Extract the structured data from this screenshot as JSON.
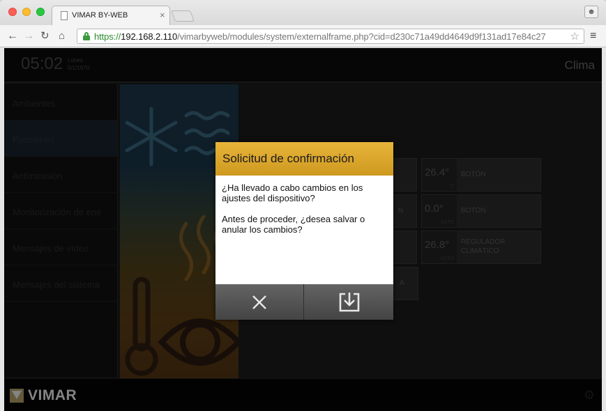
{
  "browser": {
    "tab_title": "VIMAR BY-WEB",
    "tab_close": "×",
    "url_scheme": "https://",
    "url_host": "192.168.2.110",
    "url_path": "/vimarbyweb/modules/system/externalframe.php?cid=d230c71a49dd4649d9f131ad17e84c27",
    "icons": [
      "back-arrow-icon",
      "forward-arrow-icon",
      "reload-icon",
      "home-icon",
      "lock-icon",
      "star-icon",
      "menu-icon",
      "user-icon"
    ]
  },
  "header": {
    "time": "05:02",
    "day": "Lunes",
    "date": "5/1/1970",
    "section": "Clima"
  },
  "sidebar": {
    "items": [
      {
        "label": "Ambientes"
      },
      {
        "label": "Funciones"
      },
      {
        "label": "Antiintrusión"
      },
      {
        "label": "Monitorización de ene"
      },
      {
        "label": "Mensajes de vídeo"
      },
      {
        "label": "Mensajes del sistema"
      }
    ],
    "active_index": 1
  },
  "tiles": [
    {
      "temp": "26.4°",
      "sub": "C",
      "label": "BOTÓN"
    },
    {
      "temp": "0.0°",
      "sub": "AUTO",
      "label": "BOTÓN"
    },
    {
      "temp": "26.8°",
      "sub": "AUTO",
      "label": "REGULADOR CLIMÁTICO"
    }
  ],
  "hidden_tile_fragments": [
    "N",
    "A"
  ],
  "dialog": {
    "title": "Solicitud de confirmación",
    "paragraph_1": "¿Ha llevado a cabo cambios en los ajustes del dispositivo?",
    "paragraph_2": "Antes de proceder, ¿desea salvar o anular los cambios?",
    "cancel_icon": "close-icon",
    "save_icon": "save-download-icon"
  },
  "footer": {
    "brand": "VIMAR",
    "settings_icon": "gear-icon"
  },
  "colors": {
    "dialog_header": "#d9a42a",
    "url_secure": "#2e8b2e",
    "app_background": "#1b1b1b"
  }
}
